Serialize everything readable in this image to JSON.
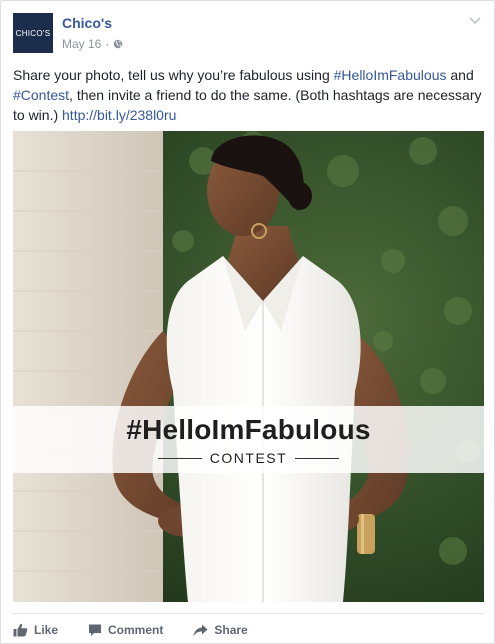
{
  "post": {
    "page_name": "Chico's",
    "logo_text": "chico's",
    "date": "May 16",
    "dot": "·",
    "audience_icon": "globe-icon",
    "text": {
      "part1": "Share your photo, tell us why you’re fabulous using ",
      "hashtag1": "#HelloImFabulous",
      "part2": " and ",
      "hashtag2": "#Contest",
      "part3": ", then invite a friend to do the same. (Both hashtags are necessary to win.) ",
      "link": "http://bit.ly/238l0ru"
    },
    "image": {
      "banner_title": "#HelloImFabulous",
      "banner_subtitle": "CONTEST"
    }
  },
  "actions": {
    "like": "Like",
    "comment": "Comment",
    "share": "Share"
  },
  "colors": {
    "link": "#365899",
    "meta": "#90949c",
    "logo_bg": "#1c2d4b",
    "action_text": "#606770"
  }
}
